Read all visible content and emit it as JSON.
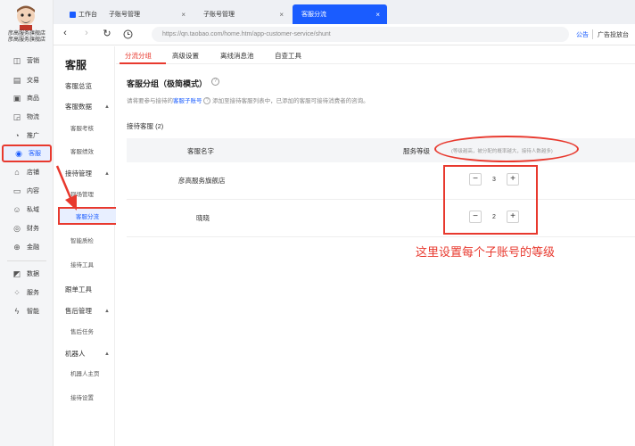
{
  "store": {
    "name_line1": "彦高服务旗舰店",
    "name_line2": "彦高服务旗舰店"
  },
  "rail": {
    "items": [
      {
        "label": "营销",
        "icon": "megaphone-icon"
      },
      {
        "label": "交易",
        "icon": "document-icon"
      },
      {
        "label": "商品",
        "icon": "box-icon"
      },
      {
        "label": "物流",
        "icon": "truck-icon"
      },
      {
        "label": "推广",
        "icon": "promotion-icon"
      },
      {
        "label": "客服",
        "icon": "headset-icon"
      },
      {
        "label": "店铺",
        "icon": "shop-icon"
      },
      {
        "label": "内容",
        "icon": "content-icon"
      },
      {
        "label": "私域",
        "icon": "people-icon"
      },
      {
        "label": "财务",
        "icon": "finance-icon"
      },
      {
        "label": "金融",
        "icon": "coin-icon"
      },
      {
        "label": "数据",
        "icon": "chart-icon"
      },
      {
        "label": "服务",
        "icon": "grid-icon"
      },
      {
        "label": "智能",
        "icon": "ai-icon"
      }
    ]
  },
  "tabs": [
    {
      "label": "工作台"
    },
    {
      "label": "子账号管理"
    },
    {
      "label": "子账号管理"
    },
    {
      "label": "客服分流"
    }
  ],
  "address": {
    "url": "https://qn.taobao.com/home.htm/app-customer-service/shunt",
    "link1": "公告",
    "link2": "广告投放台"
  },
  "subnav": {
    "title": "客服",
    "items": [
      {
        "label": "客服总览"
      },
      {
        "label": "客服数据"
      },
      {
        "label": "客服考核"
      },
      {
        "label": "客服绩效"
      },
      {
        "label": "接待管理"
      },
      {
        "label": "现场管理"
      },
      {
        "label": "客服分流"
      },
      {
        "label": "智能质检"
      },
      {
        "label": "接待工具"
      },
      {
        "label": "跟单工具"
      },
      {
        "label": "售后管理"
      },
      {
        "label": "售后任务"
      },
      {
        "label": "机器人"
      },
      {
        "label": "机器人主页"
      },
      {
        "label": "接待设置"
      }
    ]
  },
  "content": {
    "tabs": [
      "分流分组",
      "高级设置",
      "离线消息池",
      "自查工具"
    ],
    "section_title": "客服分组（极简模式）",
    "desc_prefix": "请将要参与接待的",
    "desc_link": "客服子账号",
    "desc_suffix": "添加至接待客服列表中，已添加的客服可接待消费者的咨询。",
    "count_label": "接待客服 (2)",
    "table": {
      "col_name": "客服名字",
      "col_level": "服务等级",
      "level_hint": "(等级越高，被分配的概率越大，接待人数越多)",
      "rows": [
        {
          "name": "彦高服务旗舰店",
          "level": "3"
        },
        {
          "name": "晓晓",
          "level": "2"
        }
      ]
    },
    "annotation": "这里设置每个子账号的等级"
  }
}
